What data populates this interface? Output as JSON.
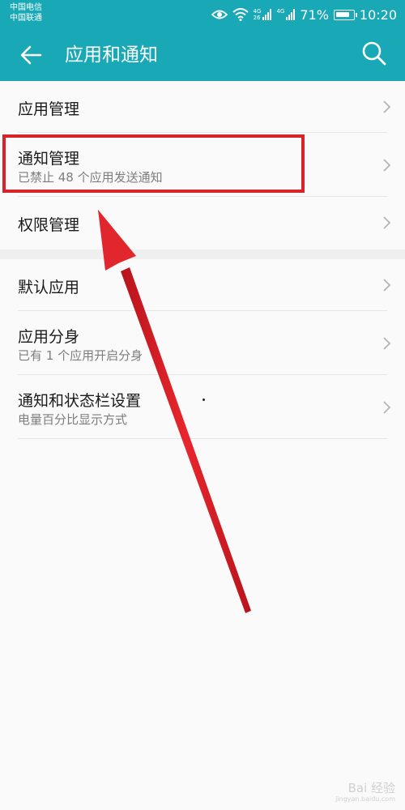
{
  "status_bar": {
    "carrier_1": "中国电信",
    "carrier_2": "中国联通",
    "net_top": "4G",
    "net_bottom": "26",
    "net_2": "4G",
    "battery_percent": "71%",
    "time": "10:20",
    "icons": [
      "eye-icon",
      "wifi-icon",
      "signal-icon",
      "battery-icon"
    ]
  },
  "app_bar": {
    "title": "应用和通知",
    "back_icon": "back-arrow-icon",
    "search_icon": "search-icon"
  },
  "section_1": [
    {
      "title": "应用管理"
    },
    {
      "title": "通知管理",
      "subtitle": "已禁止 48 个应用发送通知"
    },
    {
      "title": "权限管理"
    }
  ],
  "section_2": [
    {
      "title": "默认应用"
    },
    {
      "title": "应用分身",
      "subtitle": "已有 1 个应用开启分身"
    },
    {
      "title": "通知和状态栏设置",
      "subtitle": "电量百分比显示方式"
    }
  ],
  "watermark": {
    "brand": "Bai 经验",
    "url": "jingyan.baidu.com"
  },
  "colors": {
    "header": "#19a8b6",
    "annotation": "#d8232a"
  }
}
